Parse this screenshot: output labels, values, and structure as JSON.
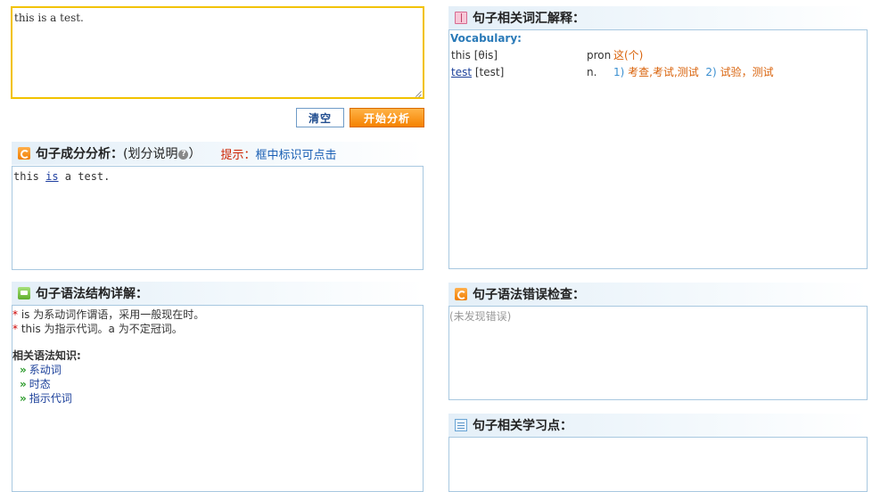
{
  "input": {
    "value": "this is a test."
  },
  "buttons": {
    "clear": "清空",
    "analyze": "开始分析"
  },
  "component_analysis": {
    "title": "句子成分分析：",
    "note": "(划分说明",
    "note_close": "）",
    "hint_label": "提示：",
    "hint_text": "框中标识可点击",
    "parsed": {
      "before": "this ",
      "verb": "is",
      "after": " a test."
    }
  },
  "grammar_detail": {
    "title": "句子语法结构详解：",
    "lines": [
      {
        "star": "*",
        "text": " is 为系动词作谓语，采用一般现在时。"
      },
      {
        "star": "*",
        "text": " this 为指示代词。a 为不定冠词。"
      }
    ],
    "knowledge_title": "相关语法知识:",
    "knowledge": [
      {
        "arrow": "»",
        "label": "系动词"
      },
      {
        "arrow": "»",
        "label": "时态"
      },
      {
        "arrow": "»",
        "label": "指示代词"
      }
    ]
  },
  "vocabulary": {
    "title": "句子相关词汇解释：",
    "heading": "Vocabulary:",
    "rows": [
      {
        "word": "this",
        "phonetic": " [θis]",
        "pos": "pron",
        "d1": "这(个)"
      },
      {
        "word": "test",
        "phonetic": " [test]",
        "pos": "n.",
        "n1": "1)",
        "d1": " 考查,考试,测试",
        "n2": "2)",
        "d2": " 试验，测试"
      }
    ]
  },
  "error_check": {
    "title": "句子语法错误检查：",
    "result": "(未发现错误)"
  },
  "learning_points": {
    "title": "句子相关学习点："
  }
}
